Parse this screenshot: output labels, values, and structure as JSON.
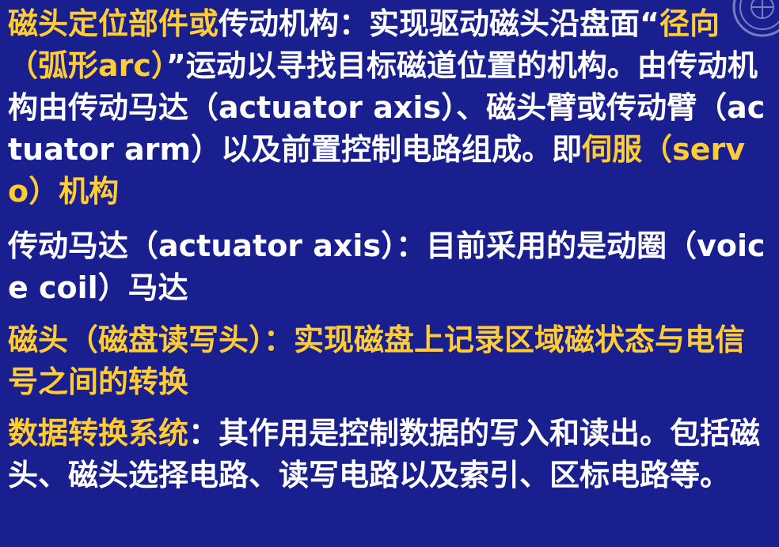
{
  "paragraphs": {
    "p1": {
      "term": "磁头定位部件或",
      "text1": "传动机构：实现驱动磁头沿盘面",
      "quote_open": "“",
      "highlight": "径向（弧形arc）",
      "quote_close": "”",
      "text2": "运动以寻找目标磁道位置的机构。由传动机构由传动马达（actuator axis）、磁头臂或传动臂（actuator arm）以及前置控制电路组成。即",
      "servo": "伺服（servo）机构"
    },
    "p2": {
      "text": "传动马达（actuator axis）：目前采用的是动圈（voice  coil）马达"
    },
    "p3": {
      "text": "磁头（磁盘读写头）：实现磁盘上记录区域磁状态与电信号之间的转换"
    },
    "p4": {
      "term": "数据转换系统",
      "text": "：其作用是控制数据的写入和读出。包括磁头、磁头选择电路、读写电路以及索引、区标电路等。"
    }
  },
  "colors": {
    "background": "#1a1f8f",
    "highlight": "#ffcc33",
    "text": "#ffffff"
  },
  "icons": {
    "corner": "university-seal-icon"
  }
}
